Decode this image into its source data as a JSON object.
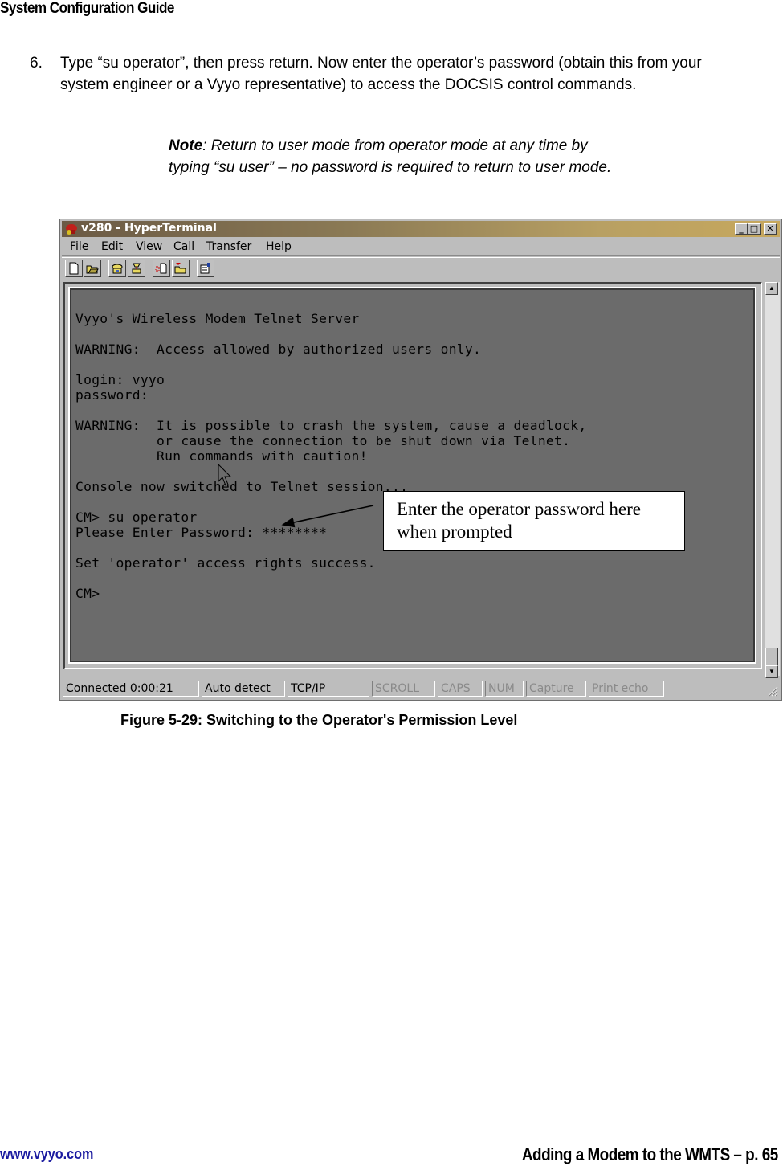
{
  "page": {
    "header": "System Configuration Guide",
    "step": {
      "number": "6.",
      "text": "Type “su operator”, then press return.  Now enter the operator’s password (obtain this from your system engineer or a Vyyo representative) to access the DOCSIS control commands."
    },
    "note": {
      "label": "Note",
      "text": ": Return to user mode from operator mode at any time by typing “su user” – no password is required to return to user mode."
    },
    "caption": "Figure 5-29: Switching to the Operator's Permission Level",
    "footer": {
      "link": "www.vyyo.com",
      "section": "Adding a Modem to the WMTS – p. 65"
    }
  },
  "window": {
    "title": "v280 - HyperTerminal",
    "title_icon": "hyperterminal-phone-icon",
    "controls": {
      "minimize": "_",
      "maximize": "□",
      "close": "✕"
    },
    "menu": [
      "File",
      "Edit",
      "View",
      "Call",
      "Transfer",
      "Help"
    ],
    "toolbar": [
      {
        "name": "new-icon"
      },
      {
        "name": "open-icon"
      },
      {
        "name": "connect-icon"
      },
      {
        "name": "disconnect-icon"
      },
      {
        "name": "send-icon"
      },
      {
        "name": "receive-icon"
      },
      {
        "name": "properties-icon"
      }
    ],
    "terminal_lines": [
      "Vyyo's Wireless Modem Telnet Server",
      "",
      "WARNING:  Access allowed by authorized users only.",
      "",
      "login: vyyo",
      "password:",
      "",
      "WARNING:  It is possible to crash the system, cause a deadlock,",
      "          or cause the connection to be shut down via Telnet.",
      "          Run commands with caution!",
      "",
      "Console now switched to Telnet session...",
      "",
      "CM> su operator",
      "Please Enter Password: ********",
      "",
      "Set 'operator' access rights success.",
      "",
      "CM>"
    ],
    "status_bar": [
      {
        "label": "Connected 0:00:21",
        "active": true
      },
      {
        "label": "Auto detect",
        "active": true
      },
      {
        "label": "TCP/IP",
        "active": true
      },
      {
        "label": "SCROLL",
        "active": false
      },
      {
        "label": "CAPS",
        "active": false
      },
      {
        "label": "NUM",
        "active": false
      },
      {
        "label": "Capture",
        "active": false
      },
      {
        "label": "Print echo",
        "active": false
      }
    ]
  },
  "callout": {
    "line1": "Enter the operator password here",
    "line2": "when prompted"
  }
}
